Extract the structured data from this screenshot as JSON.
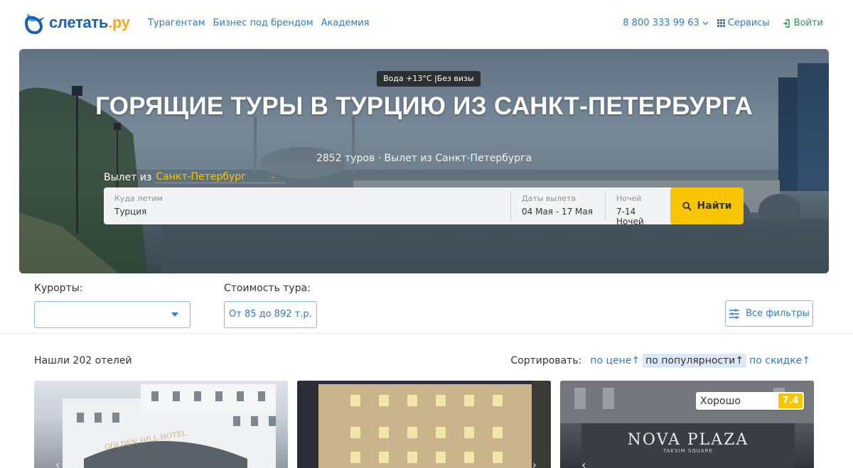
{
  "header": {
    "logo": {
      "text_main": "слетать",
      "text_suffix": ".ру",
      "icon": "bird-logo-icon"
    },
    "nav": [
      "Турагентам",
      "Бизнес под брендом",
      "Академия"
    ],
    "phone": "8 800 333 99 63",
    "services_label": "Сервисы",
    "login_label": "Войти",
    "colors": {
      "link": "#2e7ad1",
      "login": "#1b9a4a",
      "accent": "#f7c600"
    }
  },
  "hero": {
    "badge": "Вода +13°C |Без визы",
    "title": "ГОРЯЩИЕ ТУРЫ В ТУРЦИЮ ИЗ САНКТ-ПЕТЕРБУРГА",
    "subtitle": "2852 туров · Вылет из Санкт-Петербурга",
    "departure_label": "Вылет из",
    "departure_city": "Санкт-Петербург"
  },
  "search": {
    "destination_label": "Куда летим",
    "destination_value": "Турция",
    "dates_label": "Даты вылета",
    "dates_value": "04 Мая - 17 Мая",
    "nights_label": "Ночей",
    "nights_value": "7-14 Ночей",
    "button_label": "Найти"
  },
  "filters": {
    "resorts_label": "Курорты:",
    "resorts_value": "",
    "price_label": "Стоимость тура:",
    "price_value": "От 85 до 892 т.р.",
    "all_filters_label": "Все фильтры"
  },
  "results": {
    "found_text": "Нашли 202 отелей",
    "sort_label": "Сортировать:",
    "sort_options": [
      "по цене↑",
      "по популярности↑",
      "по скидке↑"
    ],
    "active_sort": "по популярности↑"
  },
  "hotels": [
    {
      "sign": "GOLDEN HILL HOTEL"
    },
    {
      "sign": ""
    },
    {
      "sign": "NOVA PLAZA",
      "sign_sub": "TAKSIM SQUARE",
      "rating_label": "Хорошо",
      "rating_score": "7.4"
    }
  ]
}
